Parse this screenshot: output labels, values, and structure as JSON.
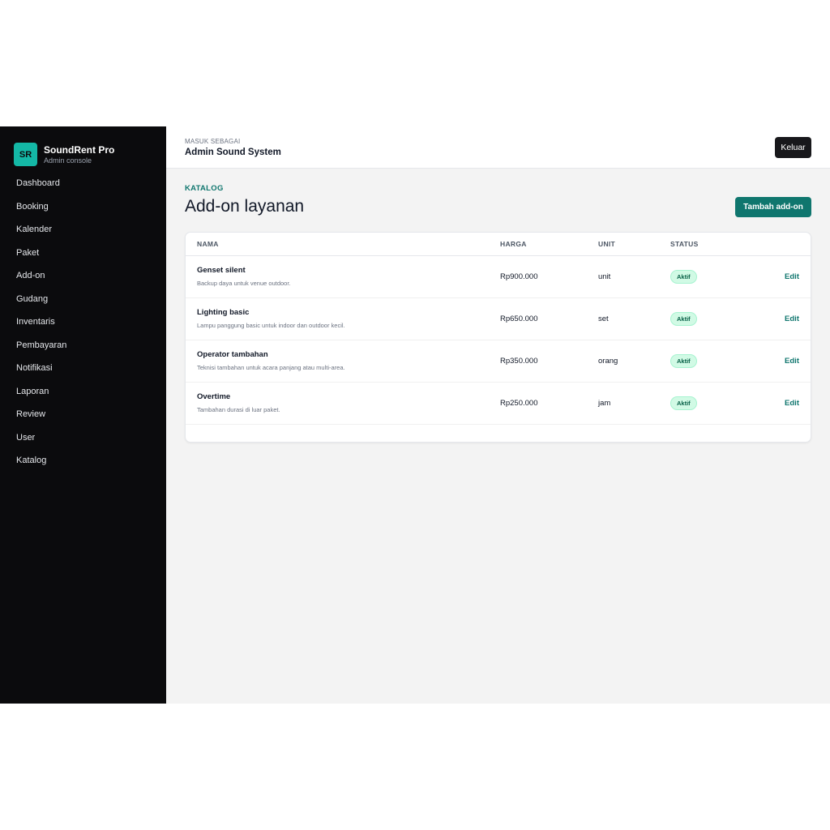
{
  "brand": {
    "logo_text": "SR",
    "title": "SoundRent Pro",
    "subtitle": "Admin console"
  },
  "sidebar": {
    "items": [
      {
        "label": "Dashboard"
      },
      {
        "label": "Booking"
      },
      {
        "label": "Kalender"
      },
      {
        "label": "Paket"
      },
      {
        "label": "Add-on"
      },
      {
        "label": "Gudang"
      },
      {
        "label": "Inventaris"
      },
      {
        "label": "Pembayaran"
      },
      {
        "label": "Notifikasi"
      },
      {
        "label": "Laporan"
      },
      {
        "label": "Review"
      },
      {
        "label": "User"
      },
      {
        "label": "Katalog"
      }
    ]
  },
  "header": {
    "signed_in_label": "MASUK SEBAGAI",
    "user_name": "Admin Sound System",
    "logout_label": "Keluar"
  },
  "page": {
    "eyebrow": "KATALOG",
    "title": "Add-on layanan",
    "add_button_label": "Tambah add-on"
  },
  "table": {
    "columns": [
      "NAMA",
      "HARGA",
      "UNIT",
      "STATUS"
    ],
    "rows": [
      {
        "name": "Genset silent",
        "description": "Backup daya untuk venue outdoor.",
        "price": "Rp900.000",
        "unit": "unit",
        "status": "Aktif",
        "action": "Edit"
      },
      {
        "name": "Lighting basic",
        "description": "Lampu panggung basic untuk indoor dan outdoor kecil.",
        "price": "Rp650.000",
        "unit": "set",
        "status": "Aktif",
        "action": "Edit"
      },
      {
        "name": "Operator tambahan",
        "description": "Teknisi tambahan untuk acara panjang atau multi-area.",
        "price": "Rp350.000",
        "unit": "orang",
        "status": "Aktif",
        "action": "Edit"
      },
      {
        "name": "Overtime",
        "description": "Tambahan durasi di luar paket.",
        "price": "Rp250.000",
        "unit": "jam",
        "status": "Aktif",
        "action": "Edit"
      }
    ]
  },
  "colors": {
    "sidebar_bg": "#0b0b0d",
    "accent": "#0f766e",
    "brand_logo": "#14b8a6",
    "badge_bg": "#d1fae5",
    "content_bg": "#f3f3f3"
  }
}
